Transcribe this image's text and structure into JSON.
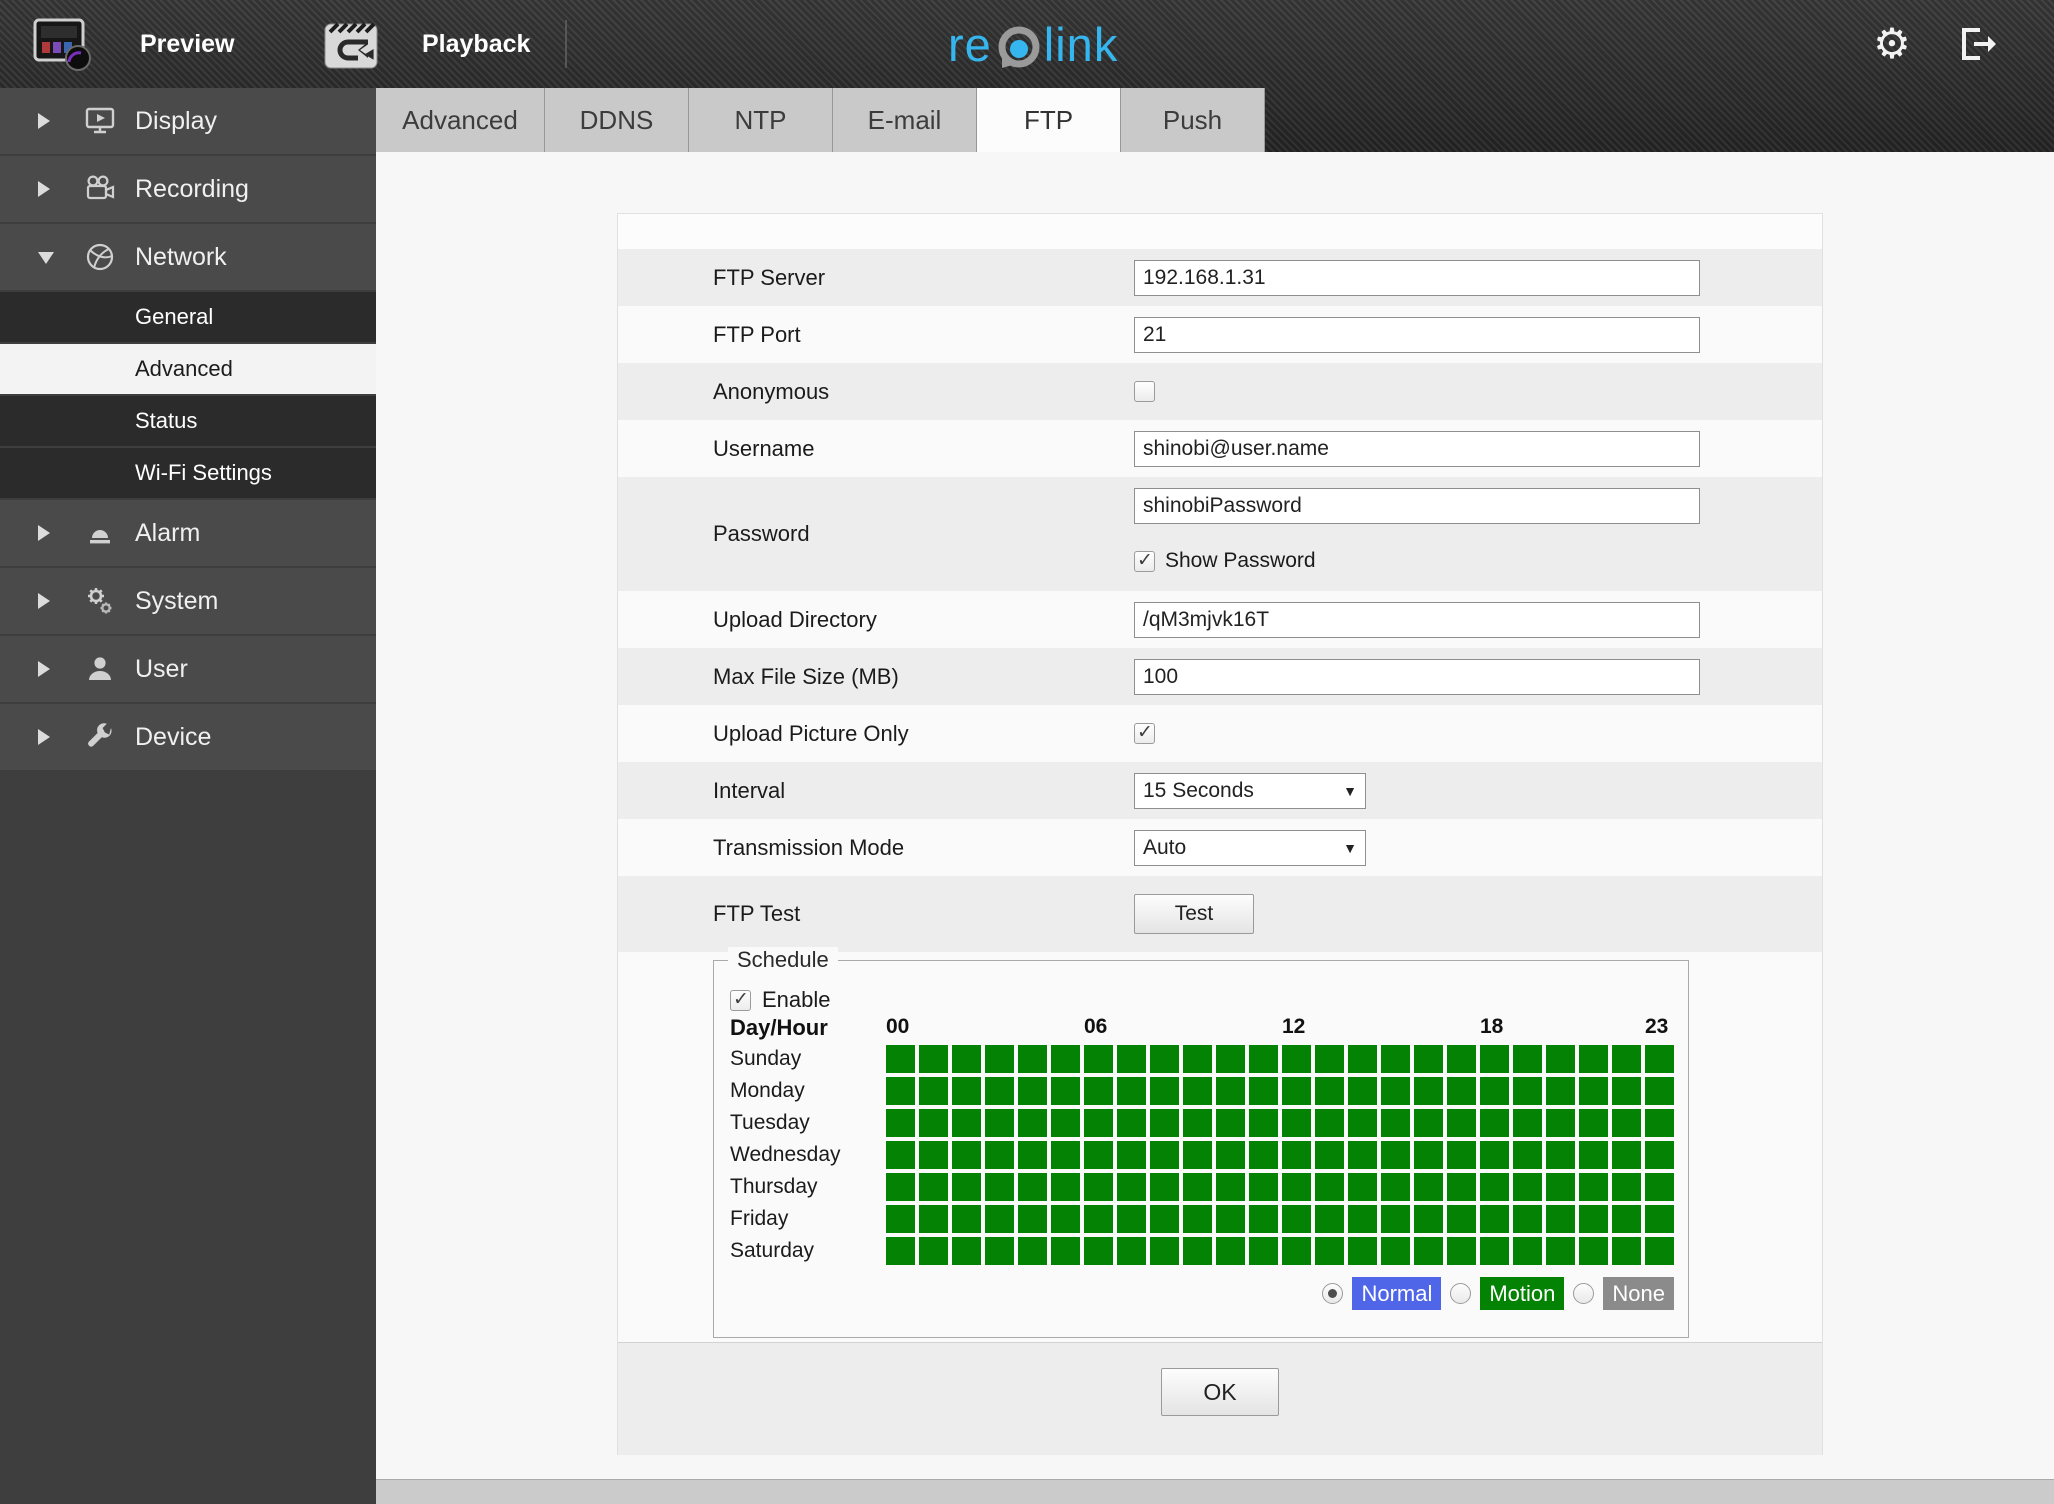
{
  "topbar": {
    "preview_label": "Preview",
    "playback_label": "Playback",
    "logo_re": "re",
    "logo_link": "link",
    "brand_blue": "#35b6ee"
  },
  "tabs": {
    "items": [
      "Advanced",
      "DDNS",
      "NTP",
      "E-mail",
      "FTP",
      "Push"
    ],
    "active": "FTP"
  },
  "sidebar": {
    "items": [
      {
        "label": "Display"
      },
      {
        "label": "Recording"
      },
      {
        "label": "Network",
        "expanded": true
      },
      {
        "label": "General",
        "sub": true
      },
      {
        "label": "Advanced",
        "sub": true,
        "active": true
      },
      {
        "label": "Status",
        "sub": true
      },
      {
        "label": "Wi-Fi Settings",
        "sub": true
      },
      {
        "label": "Alarm"
      },
      {
        "label": "System"
      },
      {
        "label": "User"
      },
      {
        "label": "Device"
      }
    ]
  },
  "form": {
    "ftp_server": {
      "label": "FTP Server",
      "value": "192.168.1.31"
    },
    "ftp_port": {
      "label": "FTP Port",
      "value": "21"
    },
    "anonymous": {
      "label": "Anonymous",
      "checked": false
    },
    "username": {
      "label": "Username",
      "value": "shinobi@user.name"
    },
    "password": {
      "label": "Password",
      "value": "shinobiPassword",
      "show_password_label": "Show Password",
      "show_password_checked": true
    },
    "upload_directory": {
      "label": "Upload Directory",
      "value": "/qM3mjvk16T"
    },
    "max_file_size": {
      "label": "Max File Size (MB)",
      "value": "100"
    },
    "upload_picture_only": {
      "label": "Upload Picture Only",
      "checked": true
    },
    "interval": {
      "label": "Interval",
      "value": "15 Seconds"
    },
    "transmission_mode": {
      "label": "Transmission Mode",
      "value": "Auto"
    },
    "ftp_test": {
      "label": "FTP Test",
      "button_label": "Test"
    }
  },
  "schedule": {
    "legend": "Schedule",
    "enable_label": "Enable",
    "enable_checked": true,
    "day_hour_label": "Day/Hour",
    "hour_labels": [
      {
        "text": "00",
        "col": 0
      },
      {
        "text": "06",
        "col": 6
      },
      {
        "text": "12",
        "col": 12
      },
      {
        "text": "18",
        "col": 18
      },
      {
        "text": "23",
        "col": 23
      }
    ],
    "days": [
      "Sunday",
      "Monday",
      "Tuesday",
      "Wednesday",
      "Thursday",
      "Friday",
      "Saturday"
    ],
    "columns": 24,
    "cell_state_all": "normal",
    "cell_color": "#048204",
    "modes": [
      {
        "label": "Normal",
        "color": "#4f66e8",
        "selected": true
      },
      {
        "label": "Motion",
        "color": "#048204",
        "selected": false
      },
      {
        "label": "None",
        "color": "#8b8b8b",
        "selected": false
      }
    ]
  },
  "ok_label": "OK"
}
